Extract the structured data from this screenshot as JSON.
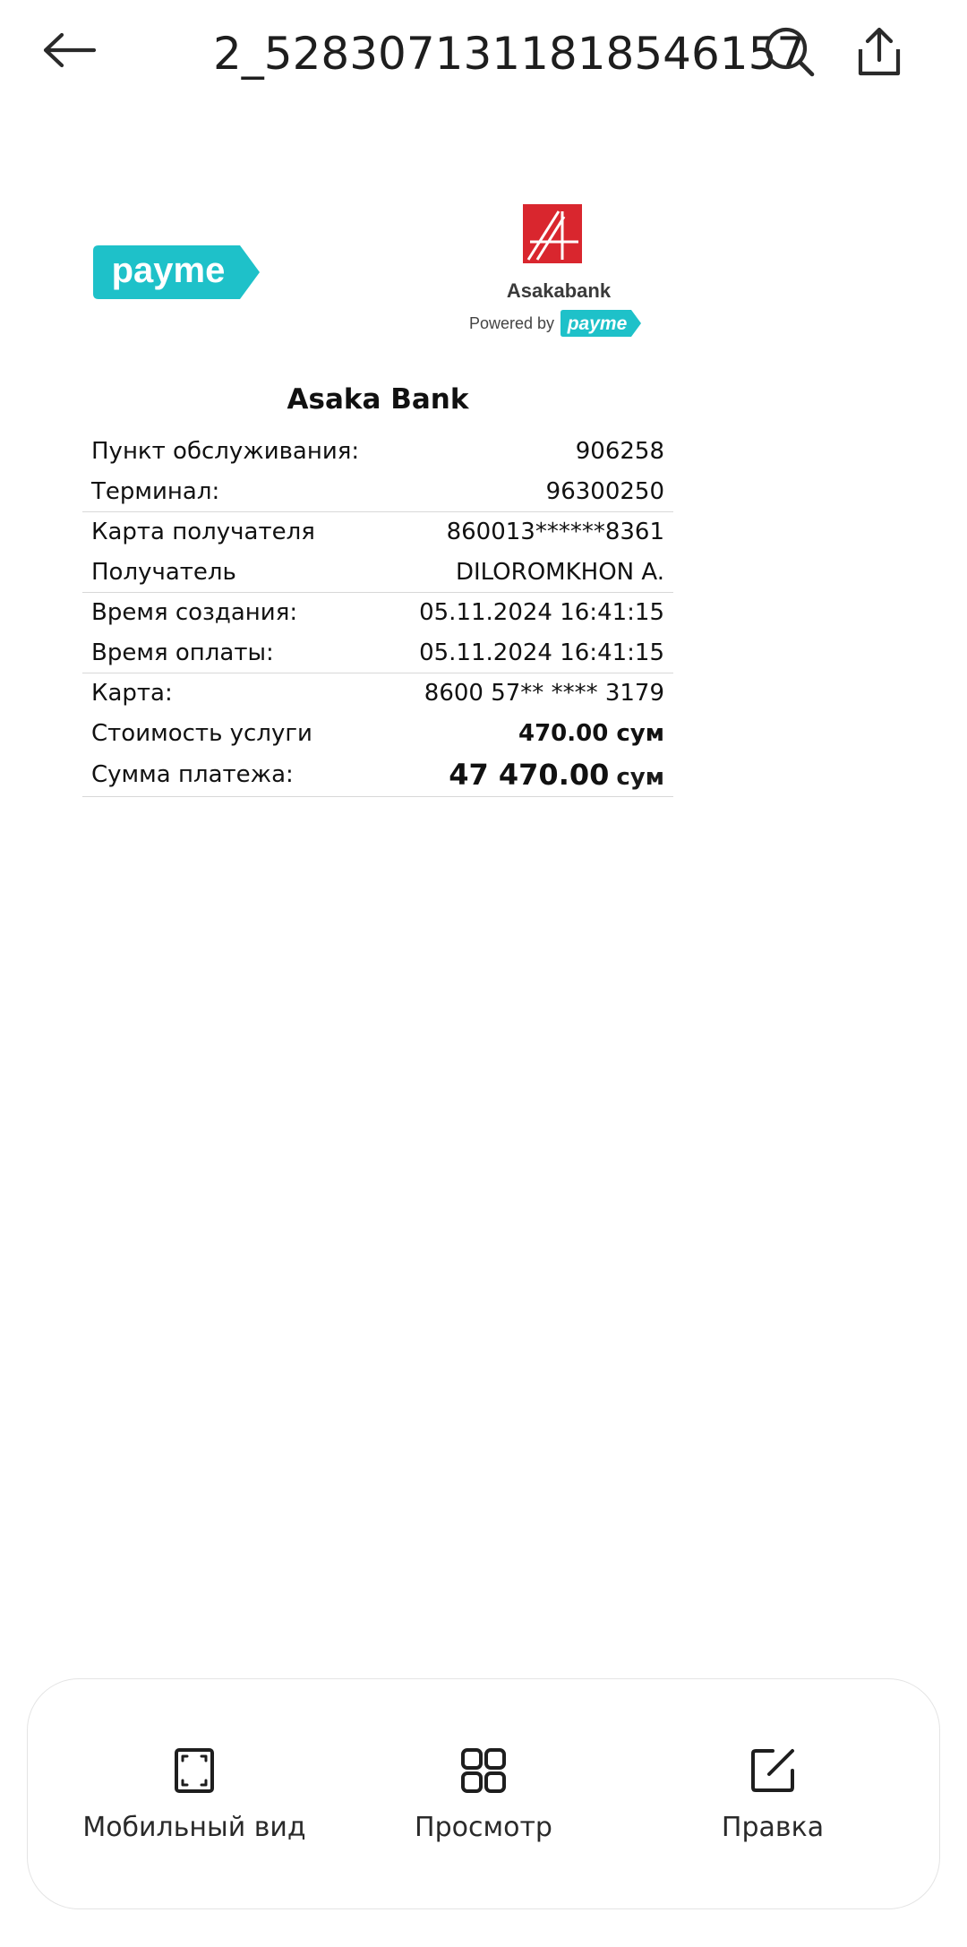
{
  "header": {
    "title": "2_5283071311818546157"
  },
  "icons": {
    "back": "arrow-left-icon",
    "search": "search-icon",
    "share": "share-icon"
  },
  "receipt": {
    "payme_logo_text": "payme",
    "asaka_logo_text": "Asakabank",
    "powered_by": "Powered by",
    "powered_logo_text": "payme",
    "bank_name": "Asaka Bank",
    "groups": [
      [
        {
          "label": "Пункт обслуживания:",
          "value": "906258"
        },
        {
          "label": "Терминал:",
          "value": "96300250"
        }
      ],
      [
        {
          "label": "Карта получателя",
          "value": "860013******8361"
        },
        {
          "label": "Получатель",
          "value": "DILOROMKHON A."
        }
      ],
      [
        {
          "label": "Время создания:",
          "value": "05.11.2024 16:41:15"
        },
        {
          "label": "Время оплаты:",
          "value": "05.11.2024 16:41:15"
        }
      ],
      [
        {
          "label": "Карта:",
          "value": "8600 57** **** 3179"
        },
        {
          "label": "Стоимость услуги",
          "value": "470.00 сум"
        },
        {
          "label": "Сумма платежа:",
          "value": "47 470.00",
          "unit": "сум"
        }
      ]
    ]
  },
  "bottom_actions": [
    {
      "label": "Мобильный вид",
      "icon": "fullscreen-icon"
    },
    {
      "label": "Просмотр",
      "icon": "grid-icon"
    },
    {
      "label": "Правка",
      "icon": "edit-icon"
    }
  ],
  "colors": {
    "payme_teal": "#1ec1c9",
    "asaka_red": "#d9262e"
  }
}
